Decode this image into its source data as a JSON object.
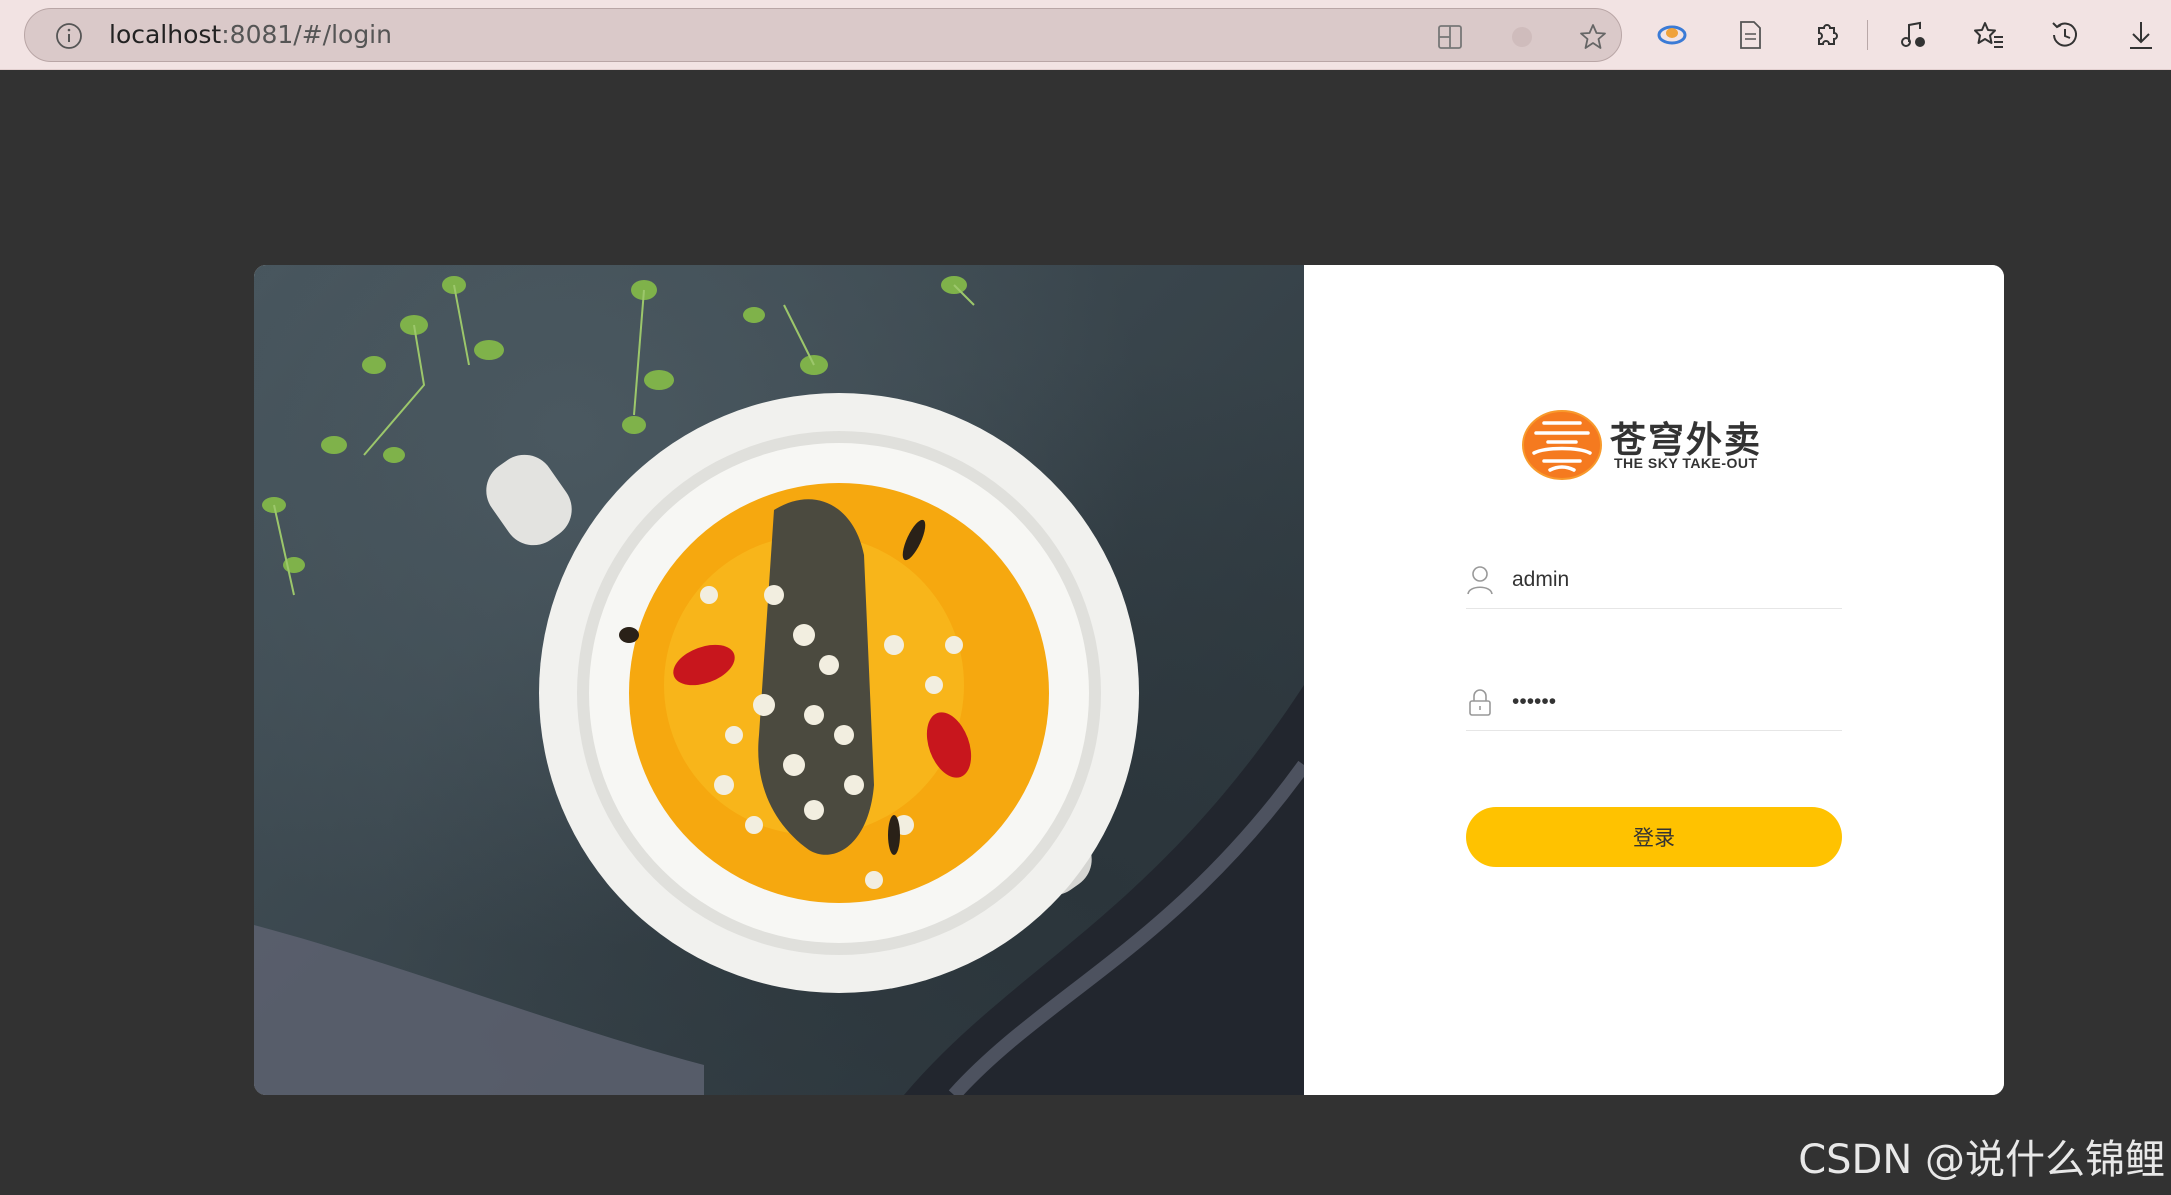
{
  "browser": {
    "url_host": "localhost",
    "url_path": ":8081/#/login",
    "toolbar_icons": [
      "site-info-icon",
      "split-screen-icon",
      "translate-icon",
      "favorite-star-icon",
      "copilot-icon",
      "reading-view-icon",
      "extensions-icon",
      "media-control-icon",
      "favorites-icon",
      "history-icon",
      "downloads-icon"
    ]
  },
  "login": {
    "logo_cn": "苍穹外卖",
    "logo_en": "THE SKY TAKE-OUT",
    "username": "admin",
    "password": "123456",
    "submit_label": "登录"
  },
  "colors": {
    "page_bg": "#323232",
    "button": "#ffc200",
    "logo_orange": "#f57a1f"
  },
  "watermark": "CSDN @说什么锦鲤"
}
